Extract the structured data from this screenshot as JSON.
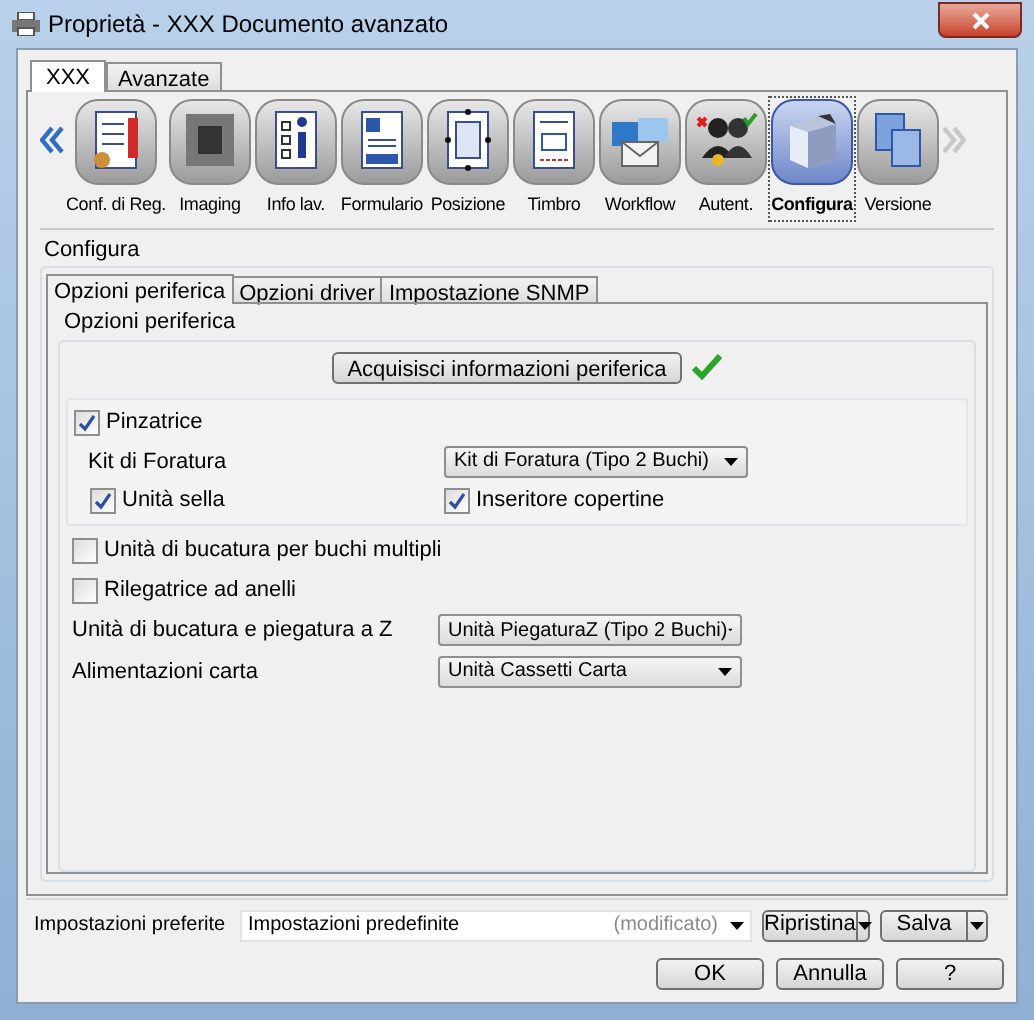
{
  "window": {
    "title": "Proprietà - XXX Documento avanzato"
  },
  "outer_tabs": [
    {
      "label": "XXX",
      "selected": true
    },
    {
      "label": "Avanzate",
      "selected": false
    }
  ],
  "toolbar": {
    "scroll_left": {
      "disabled": false
    },
    "scroll_right": {
      "disabled": true
    },
    "items": [
      {
        "label": "Conf. di Reg.",
        "selected": false
      },
      {
        "label": "Imaging",
        "selected": false
      },
      {
        "label": "Info lav.",
        "selected": false
      },
      {
        "label": "Formulario",
        "selected": false
      },
      {
        "label": "Posizione",
        "selected": false
      },
      {
        "label": "Timbro",
        "selected": false
      },
      {
        "label": "Workflow",
        "selected": false
      },
      {
        "label": "Autent.",
        "selected": false
      },
      {
        "label": "Configura",
        "selected": true
      },
      {
        "label": "Versione",
        "selected": false
      }
    ]
  },
  "section_title": "Configura",
  "inner_tabs": [
    {
      "label": "Opzioni periferica",
      "selected": true
    },
    {
      "label": "Opzioni driver",
      "selected": false
    },
    {
      "label": "Impostazione SNMP",
      "selected": false
    }
  ],
  "group_title": "Opzioni periferica",
  "acquire": {
    "label": "Acquisisci informazioni periferica",
    "done": true
  },
  "stapler": {
    "label": "Pinzatrice",
    "checked": true,
    "punch_kit": {
      "label": "Kit di Foratura",
      "value": "Kit di Foratura (Tipo 2 Buchi)"
    },
    "saddle": {
      "label": "Unità sella",
      "checked": true
    },
    "inserter": {
      "label": "Inseritore copertine",
      "checked": true
    }
  },
  "options": [
    {
      "kind": "checkbox",
      "label": "Unità di bucatura per buchi multipli",
      "checked": false
    },
    {
      "kind": "checkbox",
      "label": "Rilegatrice ad anelli",
      "checked": false
    },
    {
      "kind": "select",
      "label": "Unità di bucatura e piegatura a Z",
      "value": "Unità PiegaturaZ (Tipo 2 Buchi)"
    },
    {
      "kind": "select",
      "label": "Alimentazioni carta",
      "value": "Unità Cassetti Carta"
    }
  ],
  "preferences": {
    "label": "Impostazioni preferite",
    "value": "Impostazioni predefinite",
    "note": "(modificato)",
    "buttons": [
      "Ripristina",
      "Salva"
    ]
  },
  "buttons": [
    "OK",
    "Annulla",
    "?"
  ]
}
